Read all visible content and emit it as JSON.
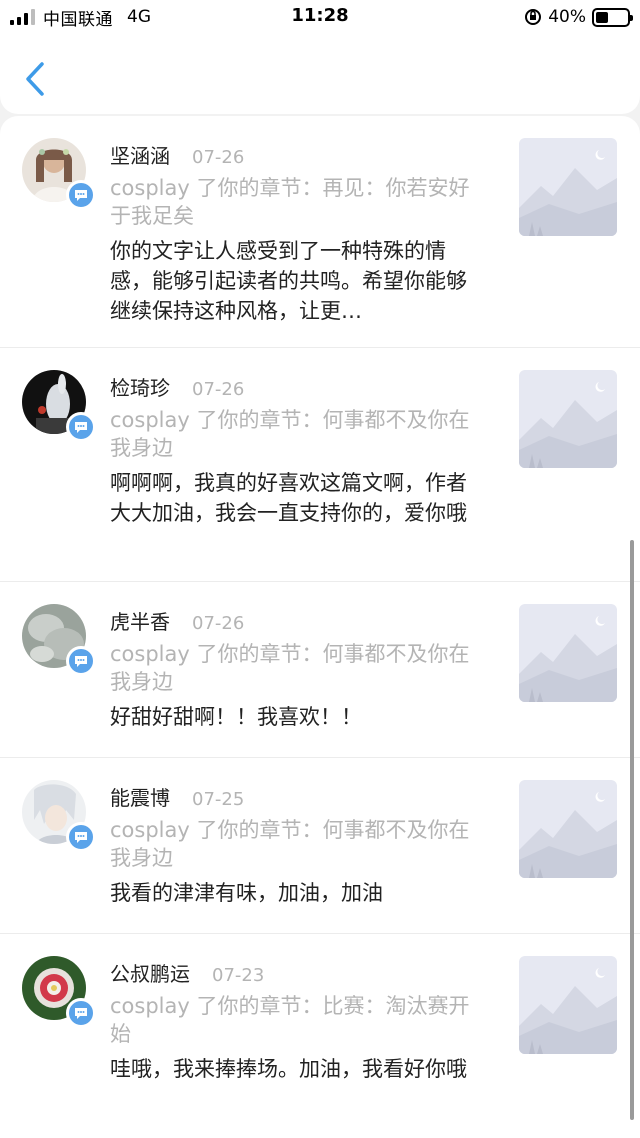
{
  "status_bar": {
    "carrier": "中国联通",
    "network": "4G",
    "time": "11:28",
    "battery": "40%",
    "battery_level": 0.4
  },
  "nav": {
    "back_icon": "chevron-left-icon"
  },
  "comments": [
    {
      "username": "坚涵涵",
      "date": "07-26",
      "chapter_line": "cosplay 了你的章节：再见：你若安好于我足矣",
      "comment": "你的文字让人感受到了一种特殊的情感，能够引起读者的共鸣。希望你能够继续保持这种风格，让更…"
    },
    {
      "username": "检琦珍",
      "date": "07-26",
      "chapter_line": "cosplay 了你的章节：何事都不及你在我身边",
      "comment": "啊啊啊，我真的好喜欢这篇文啊，作者大大加油，我会一直支持你的，爱你哦"
    },
    {
      "username": "虎半香",
      "date": "07-26",
      "chapter_line": "cosplay 了你的章节：何事都不及你在我身边",
      "comment": "好甜好甜啊！！我喜欢！！"
    },
    {
      "username": "能震博",
      "date": "07-25",
      "chapter_line": "cosplay 了你的章节：何事都不及你在我身边",
      "comment": "我看的津津有味，加油，加油"
    },
    {
      "username": "公叔鹏运",
      "date": "07-23",
      "chapter_line": "cosplay 了你的章节：比赛：淘汰赛开始",
      "comment": "哇哦，我来捧捧场。加油，我看好你哦"
    }
  ],
  "colors": {
    "accent": "#5aa3ea",
    "secondary_text": "#b4b4b4",
    "primary_text": "#222222"
  }
}
